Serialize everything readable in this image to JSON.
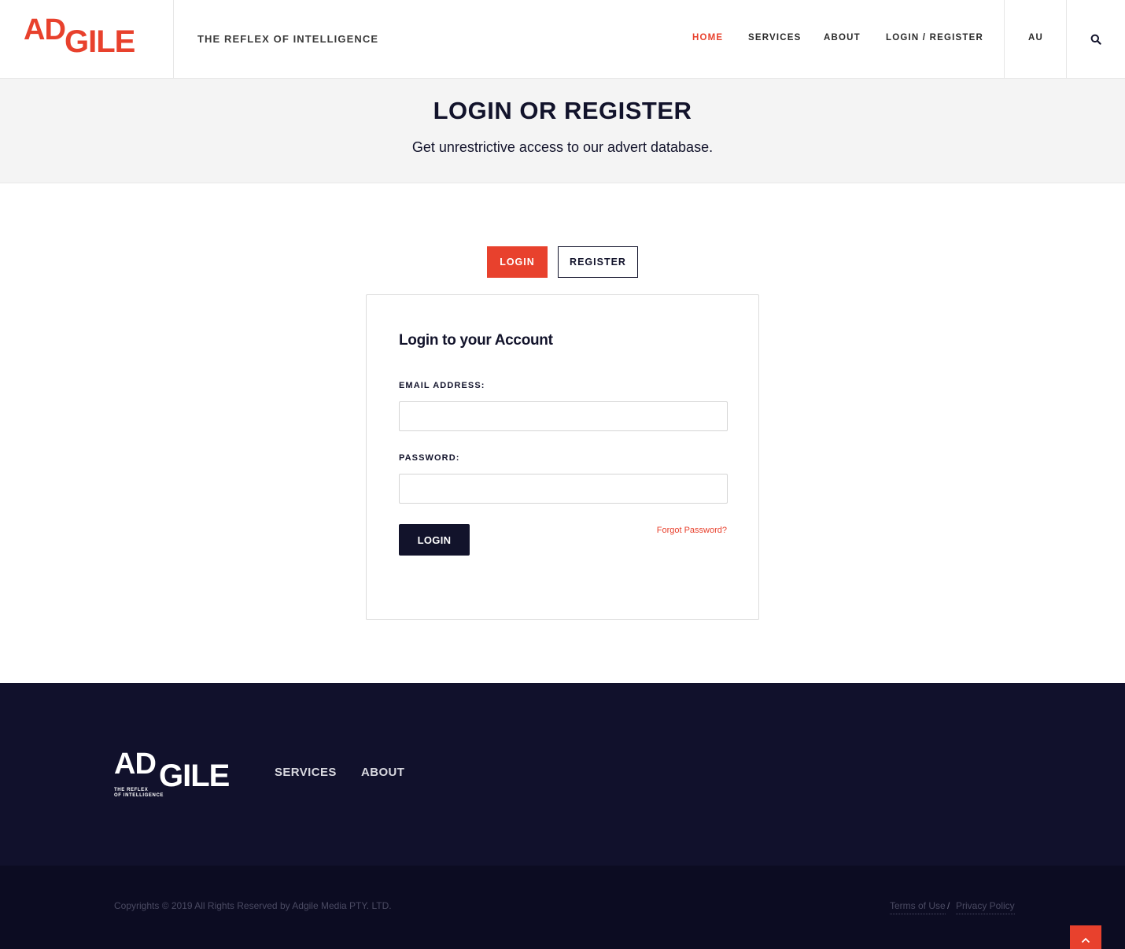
{
  "header": {
    "logo_text_ad": "AD",
    "logo_text_gile": "GILE",
    "tagline": "THE REFLEX OF INTELLIGENCE",
    "nav": {
      "home": "HOME",
      "services": "SERVICES",
      "about": "ABOUT",
      "login_register": "LOGIN / REGISTER",
      "region": "AU"
    },
    "search_icon": "search-icon"
  },
  "hero": {
    "title": "LOGIN OR REGISTER",
    "subtitle": "Get unrestrictive access to our advert database."
  },
  "tabs": {
    "login": "LOGIN",
    "register": "REGISTER",
    "active": "login"
  },
  "login_form": {
    "title": "Login to your Account",
    "email_label": "EMAIL ADDRESS:",
    "email_value": "",
    "password_label": "PASSWORD:",
    "password_value": "",
    "submit_label": "LOGIN",
    "forgot_label": "Forgot Password?"
  },
  "footer": {
    "logo_text_ad": "AD",
    "logo_text_gile": "GILE",
    "logo_tagline_line1": "THE REFLEX",
    "logo_tagline_line2": "OF INTELLIGENCE",
    "nav": {
      "services": "SERVICES",
      "about": "ABOUT"
    },
    "copyright": "Copyrights © 2019 All Rights Reserved by Adgile Media PTY. LTD.",
    "terms": "Terms of Use",
    "separator": "/",
    "privacy": "Privacy Policy",
    "back_to_top_icon": "chevron-up-icon"
  },
  "colors": {
    "brand_red": "#e8412d",
    "navy": "#12132b",
    "footer_bg": "#11112c",
    "footer_bottom_bg": "#0c0c22",
    "hero_bg": "#f4f4f4"
  }
}
